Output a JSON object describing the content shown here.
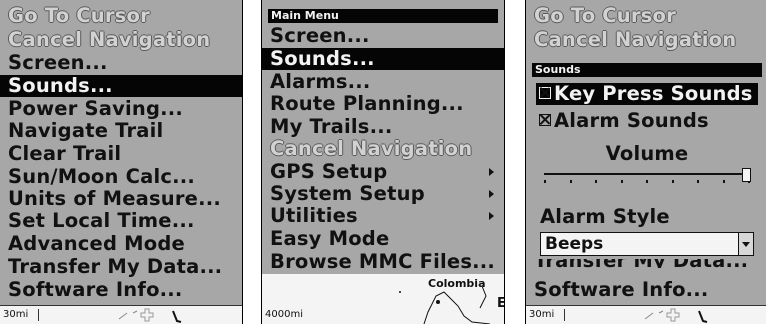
{
  "panel_left": {
    "menu_items": [
      {
        "label": "Go To Cursor",
        "state": "disabled"
      },
      {
        "label": "Cancel Navigation",
        "state": "disabled"
      },
      {
        "label": "Screen...",
        "state": "normal"
      },
      {
        "label": "Sounds...",
        "state": "selected"
      },
      {
        "label": "Power Saving...",
        "state": "normal"
      },
      {
        "label": "Navigate Trail",
        "state": "normal"
      },
      {
        "label": "Clear Trail",
        "state": "normal"
      },
      {
        "label": "Sun/Moon Calc...",
        "state": "normal"
      },
      {
        "label": "Units of Measure...",
        "state": "normal"
      },
      {
        "label": "Set Local Time...",
        "state": "normal"
      },
      {
        "label": "Advanced Mode",
        "state": "normal"
      },
      {
        "label": "Transfer My Data...",
        "state": "normal"
      },
      {
        "label": "Software Info...",
        "state": "normal"
      }
    ],
    "statusbar": {
      "scale": "30mi"
    }
  },
  "panel_middle": {
    "header": "Main Menu",
    "menu_items": [
      {
        "label": "Screen...",
        "state": "normal",
        "submenu": false
      },
      {
        "label": "Sounds...",
        "state": "selected",
        "submenu": false
      },
      {
        "label": "Alarms...",
        "state": "normal",
        "submenu": false
      },
      {
        "label": "Route Planning...",
        "state": "normal",
        "submenu": false
      },
      {
        "label": "My Trails...",
        "state": "normal",
        "submenu": false
      },
      {
        "label": "Cancel Navigation",
        "state": "disabled",
        "submenu": false
      },
      {
        "label": "GPS Setup",
        "state": "normal",
        "submenu": true
      },
      {
        "label": "System Setup",
        "state": "normal",
        "submenu": true
      },
      {
        "label": "Utilities",
        "state": "normal",
        "submenu": true
      },
      {
        "label": "Easy Mode",
        "state": "normal",
        "submenu": false
      },
      {
        "label": "Browse MMC Files...",
        "state": "normal",
        "submenu": false
      }
    ],
    "map": {
      "scale": "4000mi",
      "place_label": "Colombia",
      "edge_label": "E"
    }
  },
  "panel_right": {
    "background_items": [
      {
        "label": "Go To Cursor"
      },
      {
        "label": "Cancel Navigation"
      }
    ],
    "dialog": {
      "title": "Sounds",
      "options": [
        {
          "label": "Key Press Sounds",
          "checked": true,
          "selected": true
        },
        {
          "label": "Alarm Sounds",
          "checked": true,
          "selected": false
        }
      ],
      "volume_label": "Volume",
      "volume_level": 1.0,
      "alarm_style_label": "Alarm Style",
      "alarm_style_value": "Beeps"
    },
    "partial_item": "Transfer My Data...",
    "bottom_item": "Software Info...",
    "statusbar": {
      "scale": "30mi"
    }
  }
}
